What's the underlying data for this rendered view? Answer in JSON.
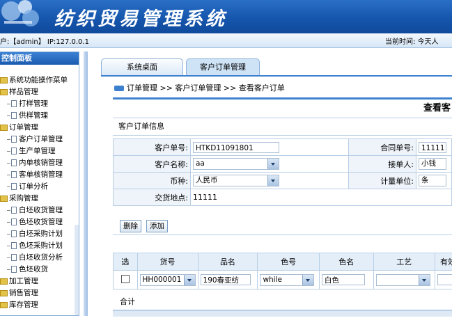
{
  "header": {
    "title": "纺织贸易管理系统",
    "user_info": "户:【admin】 IP:127.0.0.1",
    "time_info": "当前时间: 今天人"
  },
  "sidebar": {
    "title": "控制面板",
    "items": [
      {
        "label": "系统功能操作菜单",
        "type": "folder",
        "level": 0
      },
      {
        "label": "样品管理",
        "type": "folder",
        "level": 0
      },
      {
        "label": "打样管理",
        "type": "doc",
        "level": 1
      },
      {
        "label": "供样管理",
        "type": "doc",
        "level": 1
      },
      {
        "label": "订单管理",
        "type": "folder",
        "level": 0
      },
      {
        "label": "客户订单管理",
        "type": "doc",
        "level": 1
      },
      {
        "label": "生产单管理",
        "type": "doc",
        "level": 1
      },
      {
        "label": "内单核销管理",
        "type": "doc",
        "level": 1
      },
      {
        "label": "客单核销管理",
        "type": "doc",
        "level": 1
      },
      {
        "label": "订单分析",
        "type": "doc",
        "level": 1
      },
      {
        "label": "采购管理",
        "type": "folder",
        "level": 0
      },
      {
        "label": "白坯收货管理",
        "type": "doc",
        "level": 1
      },
      {
        "label": "色坯收货管理",
        "type": "doc",
        "level": 1
      },
      {
        "label": "白坯采购计划",
        "type": "doc",
        "level": 1
      },
      {
        "label": "色坯采购计划",
        "type": "doc",
        "level": 1
      },
      {
        "label": "白坯收货分析",
        "type": "doc",
        "level": 1
      },
      {
        "label": "色坯收货",
        "type": "doc",
        "level": 1
      },
      {
        "label": "加工管理",
        "type": "folder",
        "level": 0
      },
      {
        "label": "销售管理",
        "type": "folder",
        "level": 0
      },
      {
        "label": "库存管理",
        "type": "folder",
        "level": 0
      }
    ]
  },
  "tabs": [
    {
      "label": "系统桌面"
    },
    {
      "label": "客户订单管理"
    }
  ],
  "breadcrumb": "订单管理 >> 客户订单管理 >> 查看客户订单",
  "panel": {
    "title": "查看客",
    "section": "客户订单信息",
    "fields": {
      "customer_no_label": "客户单号:",
      "customer_no": "HTKD11091801",
      "contract_no_label": "合同单号:",
      "contract_no": "11111",
      "customer_name_label": "客户名称:",
      "customer_name": "aa",
      "receiver_label": "接单人:",
      "receiver": "小钱",
      "currency_label": "币种:",
      "currency": "人民币",
      "unit_label": "计量单位:",
      "unit": "条",
      "delivery_label": "交货地点:",
      "delivery": "11111"
    },
    "buttons": {
      "delete": "删除",
      "add": "添加"
    },
    "grid": {
      "columns": [
        "选",
        "货号",
        "品名",
        "色号",
        "色名",
        "工艺",
        "有效"
      ],
      "rows": [
        {
          "item_no": "HH000001",
          "name": "190春亚纺",
          "color_no": "while",
          "color_name": "白色",
          "craft": ""
        }
      ]
    },
    "total_label": "合计"
  }
}
